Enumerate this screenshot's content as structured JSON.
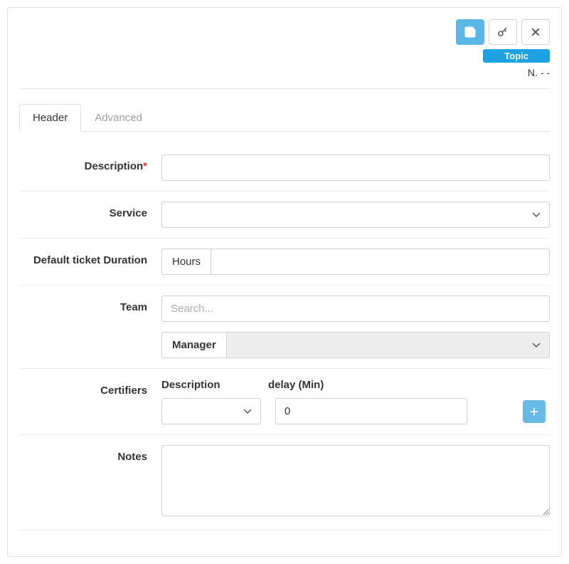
{
  "toolbar": {
    "save_icon": "save",
    "key_icon": "key",
    "close_icon": "close"
  },
  "badge": {
    "label": "Topic"
  },
  "meta": {
    "prefix": "N.",
    "number": "- -"
  },
  "tabs": [
    {
      "id": "header",
      "label": "Header",
      "active": true
    },
    {
      "id": "advanced",
      "label": "Advanced",
      "active": false
    }
  ],
  "form": {
    "description": {
      "label": "Description",
      "required": true,
      "value": ""
    },
    "service": {
      "label": "Service",
      "value": ""
    },
    "duration": {
      "label": "Default ticket Duration",
      "unit": "Hours",
      "value": ""
    },
    "team": {
      "label": "Team",
      "search_placeholder": "Search...",
      "search_value": "",
      "manager_label": "Manager",
      "manager_value": ""
    },
    "certifiers": {
      "label": "Certifiers",
      "col_description": "Description",
      "col_delay": "delay (Min)",
      "rows": [
        {
          "description": "",
          "delay": "0"
        }
      ]
    },
    "notes": {
      "label": "Notes",
      "value": ""
    }
  }
}
